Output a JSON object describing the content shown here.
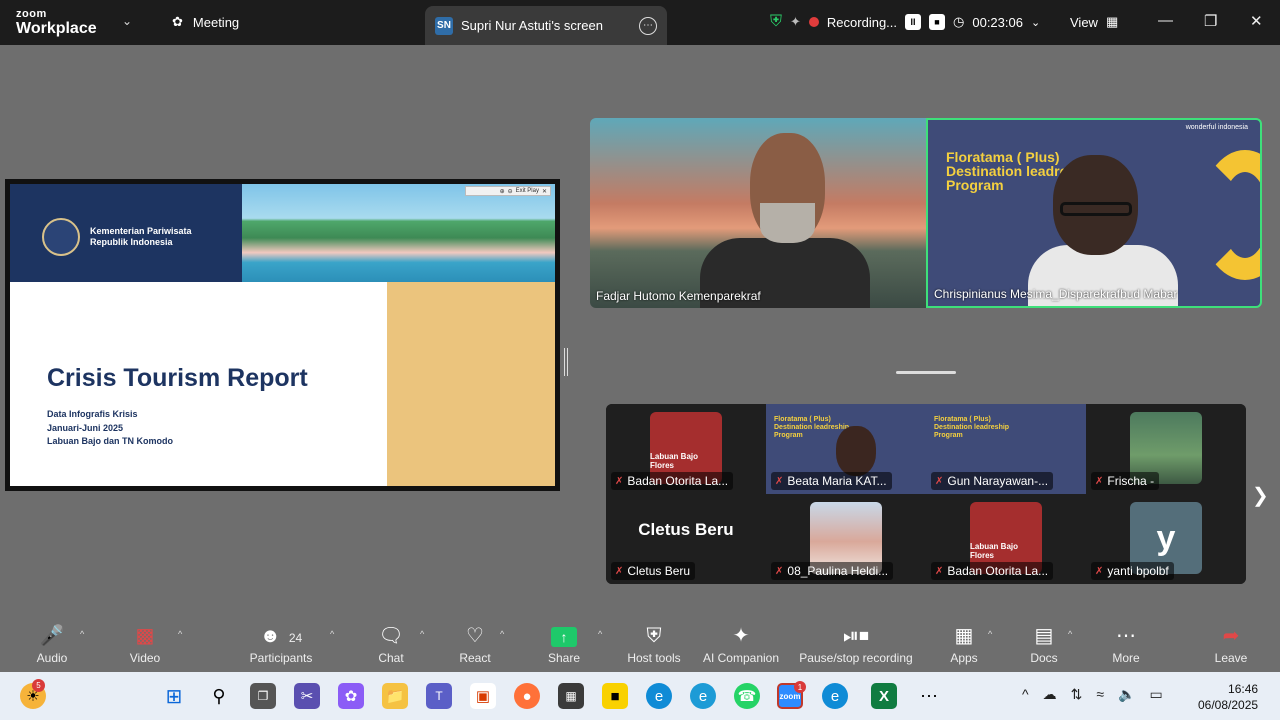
{
  "titlebar": {
    "logo_line1": "zoom",
    "logo_line2": "Workplace",
    "meeting_tab": "Meeting",
    "screen_tab_badge": "SN",
    "screen_tab": "Supri Nur Astuti's screen",
    "recording_label": "Recording...",
    "timer": "00:23:06",
    "view_label": "View"
  },
  "slide": {
    "ministry_line1": "Kementerian Pariwisata",
    "ministry_line2": "Republik Indonesia",
    "mini_toolbar": "Exit Play",
    "title": "Crisis Tourism Report",
    "sub1": "Data Infografis Krisis",
    "sub2": "Januari-Juni 2025",
    "sub3": "Labuan Bajo dan TN Komodo"
  },
  "speakers": [
    {
      "name": "Fadjar Hutomo Kemenparekraf"
    },
    {
      "name": "Chrispinianus Mesima_Disparekrafbud Mabar",
      "bg_title": "Floratama ( Plus) Destination leadre Program",
      "brand": "wonderful indonesia"
    }
  ],
  "gallery": [
    {
      "name": "Badan Otorita La...",
      "thumb": "Labuan Bajo Flores"
    },
    {
      "name": "Beata Maria KAT...",
      "flora": "Floratama ( Plus) Destination leadreship Program"
    },
    {
      "name": "Gun Narayawan-...",
      "flora": "Floratama ( Plus) Destination leadreship Program"
    },
    {
      "name": "Frischa -"
    },
    {
      "name": "Cletus Beru",
      "big": "Cletus Beru"
    },
    {
      "name": "08_Paulina Heldi..."
    },
    {
      "name": "Badan Otorita La...",
      "thumb": "Labuan Bajo Flores"
    },
    {
      "name": "yanti bpolbf",
      "letter": "y"
    }
  ],
  "toolbar": {
    "audio": "Audio",
    "video": "Video",
    "participants": "Participants",
    "participants_count": "24",
    "chat": "Chat",
    "react": "React",
    "share": "Share",
    "host_tools": "Host tools",
    "ai_companion": "AI Companion",
    "pause_recording": "Pause/stop recording",
    "apps": "Apps",
    "docs": "Docs",
    "more": "More",
    "leave": "Leave"
  },
  "taskbar": {
    "weather_badge": "5",
    "zoom_badge": "1",
    "time": "16:46",
    "date": "06/08/2025"
  },
  "colors": {
    "titlebar": "#1c1c1c",
    "meeting_bg": "#6e6e6e",
    "active_speaker_border": "#3ee07a",
    "share_green": "#1ec96a",
    "mute_red": "#e04848",
    "slide_navy": "#1d3461",
    "slide_gold": "#ebc47d"
  }
}
